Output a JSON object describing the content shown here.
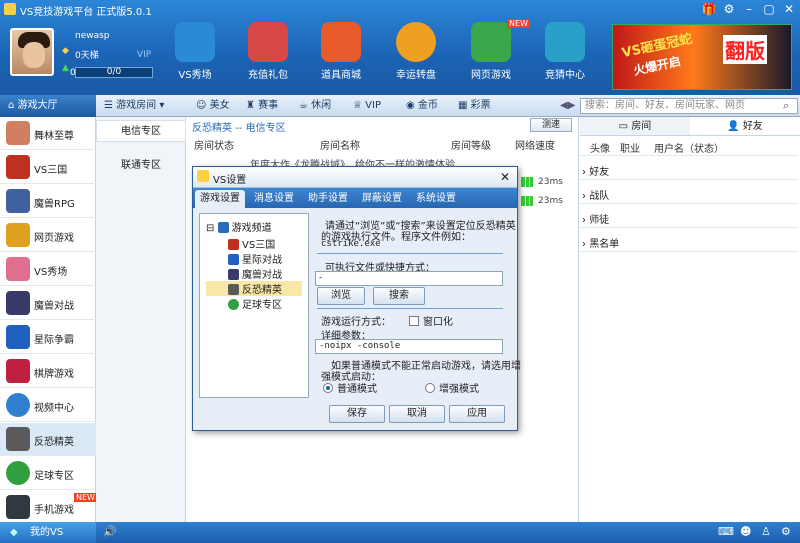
{
  "window": {
    "title": "VS竞技游戏平台  正式版5.0.1",
    "controls": [
      "gift-icon",
      "gear-icon",
      "minimize-icon",
      "restore-icon",
      "close-icon"
    ]
  },
  "user": {
    "name": "newasp",
    "ladder": "0天梯",
    "vip": "VIP",
    "level": "0级",
    "progress": "0/0"
  },
  "nav": [
    {
      "label": "VS秀场",
      "icon": "microphone-icon",
      "color": "#2a8ad8"
    },
    {
      "label": "充值礼包",
      "icon": "gift-icon",
      "color": "#d84848"
    },
    {
      "label": "道具商城",
      "icon": "shop-icon",
      "color": "#e85a2a"
    },
    {
      "label": "幸运转盘",
      "icon": "wheel-icon",
      "color": "#f0a020"
    },
    {
      "label": "网页游戏",
      "icon": "gamepad-icon",
      "color": "#3aa84a",
      "badge": "NEW"
    },
    {
      "label": "竞猜中心",
      "icon": "quiz-icon",
      "color": "#2aa0c8"
    }
  ],
  "banner": {
    "line1": "VS砸蛋冠蛇",
    "line2": "火爆开启",
    "line3": "翻版"
  },
  "tabs": {
    "hall": "游戏大厅",
    "rooms": "游戏房间",
    "items": [
      "美女",
      "赛事",
      "休闲",
      "VIP",
      "金币",
      "彩票"
    ]
  },
  "search": {
    "placeholder": "搜索：房间、好友、房间玩家、网页"
  },
  "sidebar": [
    {
      "label": "舞林至尊",
      "color": "#d08060"
    },
    {
      "label": "VS三国",
      "color": "#c03020"
    },
    {
      "label": "魔兽RPG",
      "color": "#4060a0"
    },
    {
      "label": "网页游戏",
      "color": "#e0a020"
    },
    {
      "label": "VS秀场",
      "color": "#e07090"
    },
    {
      "label": "魔兽对战",
      "color": "#3a3a6a"
    },
    {
      "label": "星际争霸",
      "color": "#2060c0"
    },
    {
      "label": "棋牌游戏",
      "color": "#c02040"
    },
    {
      "label": "视频中心",
      "color": "#3080d0"
    },
    {
      "label": "反恐精英",
      "color": "#5a5a5a"
    },
    {
      "label": "足球专区",
      "color": "#30a040"
    },
    {
      "label": "手机游戏",
      "color": "#303840",
      "badge": "NEW"
    }
  ],
  "col2": {
    "items": [
      "电信专区",
      "联通专区"
    ]
  },
  "main": {
    "breadcrumb": "反恐精英 -- 电信专区",
    "speed_button": "测速",
    "headers": [
      "房间状态",
      "房间名称",
      "房间等级",
      "网络速度"
    ],
    "notice": "年度大作《龙腾战域》，给你不一样的激情体验",
    "speeds": [
      "23ms",
      "23ms"
    ]
  },
  "right": {
    "tabs": [
      "房间",
      "好友"
    ],
    "headers": [
      "头像",
      "职业",
      "用户名（状态）"
    ],
    "groups": [
      "好友",
      "战队",
      "师徒",
      "黑名单"
    ]
  },
  "status": {
    "myvs": "我的VS"
  },
  "dialog": {
    "title": "VS设置",
    "tabs": [
      "游戏设置",
      "消息设置",
      "助手设置",
      "屏蔽设置",
      "系统设置"
    ],
    "tree": {
      "root": "游戏频道",
      "children": [
        {
          "label": "VS三国",
          "color": "#c03020"
        },
        {
          "label": "星际对战",
          "color": "#2060c0"
        },
        {
          "label": "魔兽对战",
          "color": "#3a3a6a"
        },
        {
          "label": "反恐精英",
          "color": "#5a5a5a"
        },
        {
          "label": "足球专区",
          "color": "#30a040"
        }
      ]
    },
    "intro1": "请通过“浏览”或“搜索”来设置定位反恐精英",
    "intro2": "的游戏执行文件。程序文件例如：",
    "example": "cstrike.exe",
    "exe_label": "可执行文件或快捷方式：",
    "exe_value": "-",
    "browse": "浏览",
    "search": "搜索",
    "mode_label": "游戏运行方式：",
    "windowed": "窗口化",
    "params_label": "详细参数：",
    "params_value": "-noipx -console",
    "enhanced_note1": "如果普通模式不能正常启动游戏，请选用增",
    "enhanced_note2": "强模式启动：",
    "normal_mode": "普通模式",
    "enhanced_mode": "增强模式",
    "save": "保存",
    "cancel": "取消",
    "apply": "应用"
  }
}
